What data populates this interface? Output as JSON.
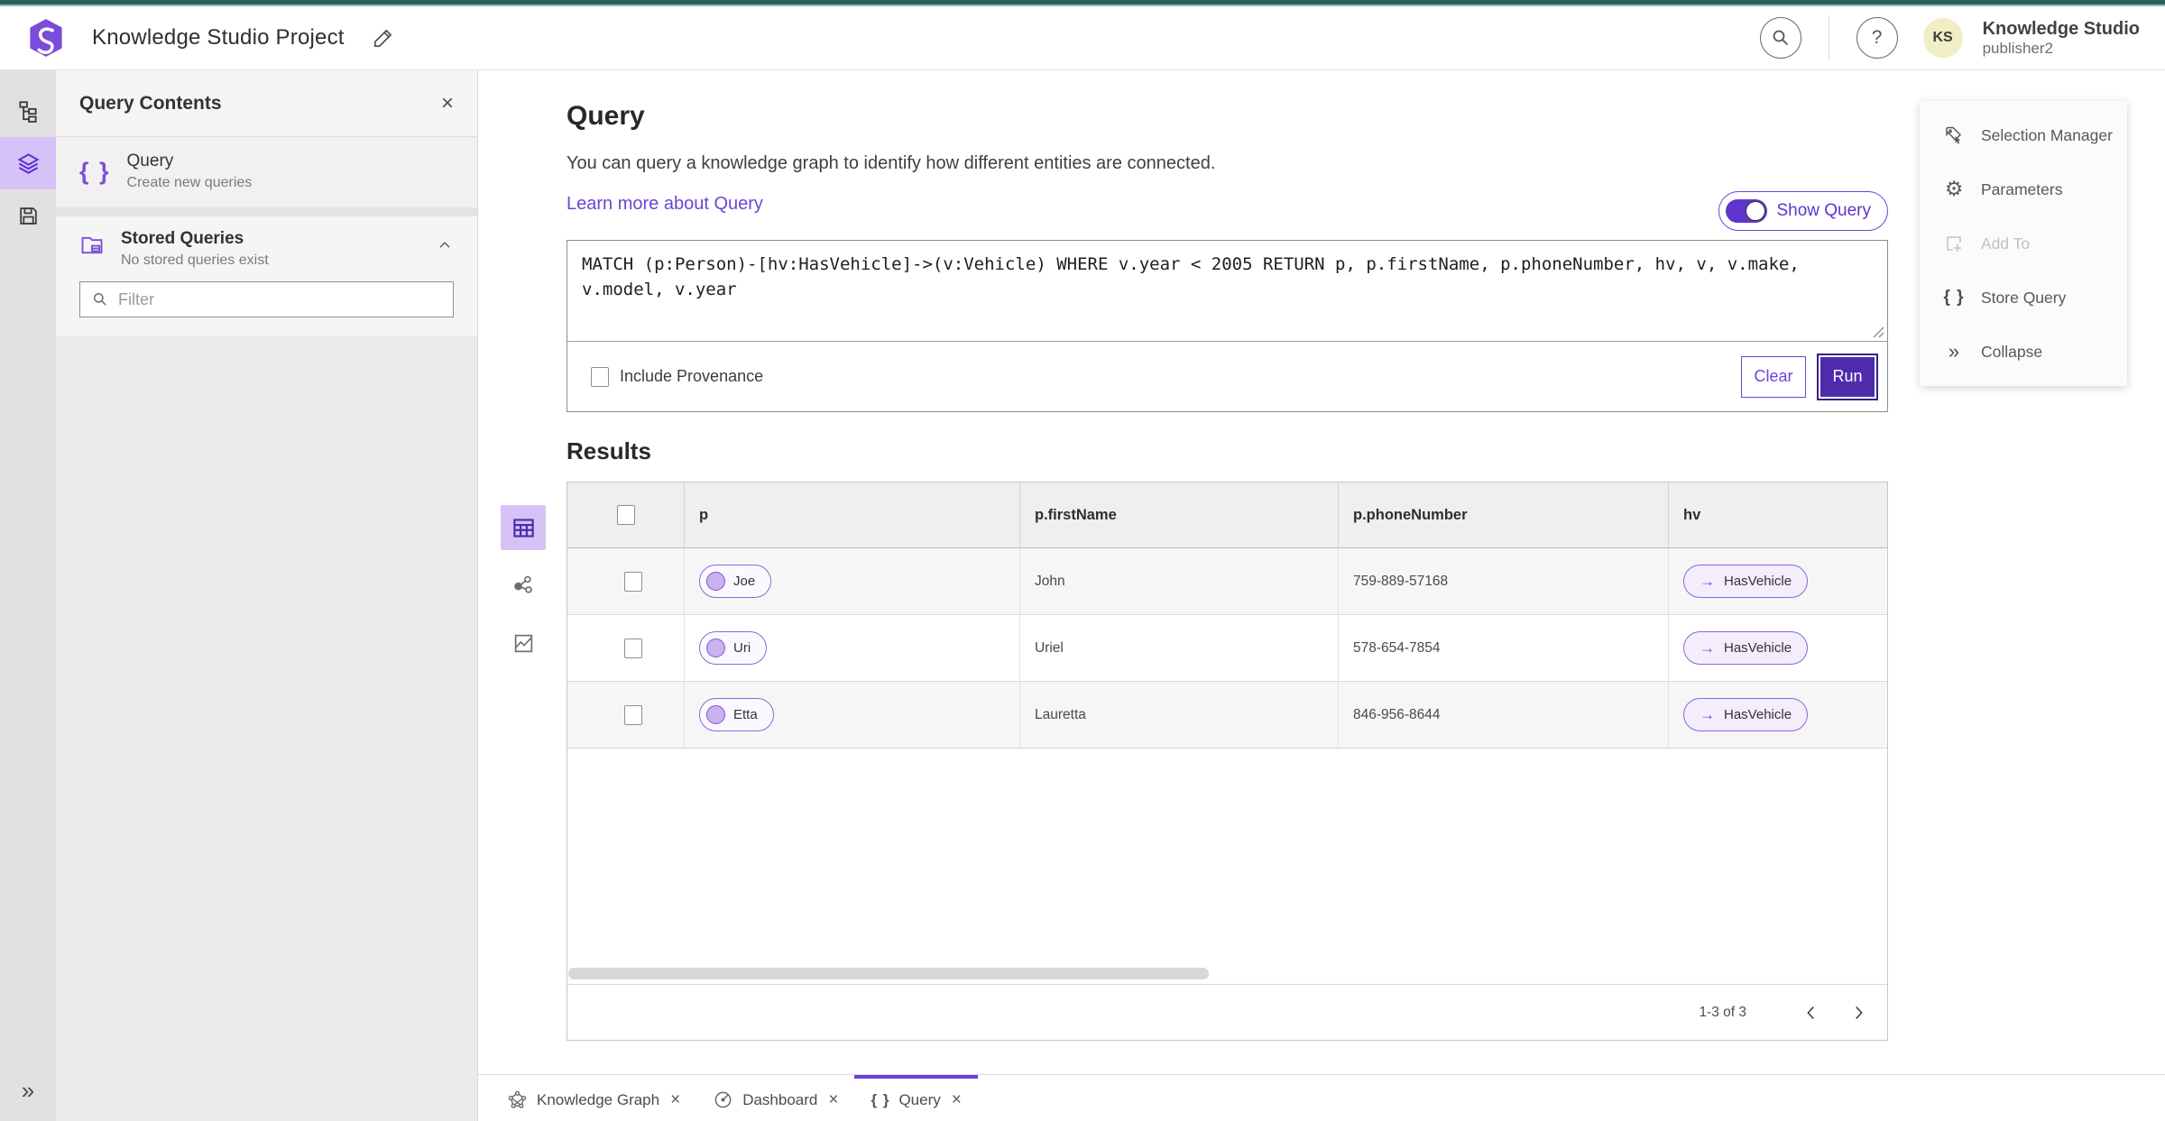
{
  "colors": {
    "accent_purple": "#6b44d8",
    "deep_purple": "#4f2bac",
    "light_purple_bg": "#d6c2f6",
    "teal_bar": "#265f5e",
    "avatar_bg": "#f1edc4"
  },
  "icons": {
    "logo": "hexagon-swirl",
    "edit": "pencil",
    "search": "magnifier",
    "help_glyph": "?",
    "close_glyph": "×",
    "rail": [
      "hierarchy-tree",
      "layers",
      "save-floppy"
    ],
    "double_chevron_glyph": "»",
    "braces_glyph": "{ }",
    "arrow_right_glyph": "→",
    "gear_glyph": "⚙",
    "view_modes": [
      "table-grid",
      "network-graph",
      "map-route"
    ],
    "tab_icons": [
      "graph-network",
      "gauge",
      "braces"
    ]
  },
  "header": {
    "app_title": "Knowledge Studio Project",
    "user": {
      "initials": "KS",
      "product": "Knowledge Studio",
      "username": "publisher2"
    }
  },
  "left_panel": {
    "title": "Query Contents",
    "query_item": {
      "title": "Query",
      "subtitle": "Create new queries"
    },
    "stored": {
      "title": "Stored Queries",
      "subtitle": "No stored queries exist"
    },
    "filter_placeholder": "Filter"
  },
  "main": {
    "title": "Query",
    "description": "You can query a knowledge graph to identify how different entities are connected.",
    "learn_more": "Learn more about Query",
    "show_query_label": "Show Query",
    "query_text": "MATCH (p:Person)-[hv:HasVehicle]->(v:Vehicle) WHERE v.year < 2005 RETURN p, p.firstName, p.phoneNumber, hv, v, v.make, v.model, v.year",
    "include_provenance_label": "Include Provenance",
    "clear_label": "Clear",
    "run_label": "Run",
    "results_title": "Results"
  },
  "results_table": {
    "columns": [
      "p",
      "p.firstName",
      "p.phoneNumber",
      "hv"
    ],
    "rows": [
      {
        "p": "Joe",
        "firstName": "John",
        "phoneNumber": "759-889-57168",
        "hv": "HasVehicle"
      },
      {
        "p": "Uri",
        "firstName": "Uriel",
        "phoneNumber": "578-654-7854",
        "hv": "HasVehicle"
      },
      {
        "p": "Etta",
        "firstName": "Lauretta",
        "phoneNumber": "846-956-8644",
        "hv": "HasVehicle"
      }
    ],
    "pagination": {
      "label": "1-3 of 3"
    }
  },
  "right_panel": {
    "items": [
      {
        "label": "Selection Manager",
        "disabled": false
      },
      {
        "label": "Parameters",
        "disabled": false
      },
      {
        "label": "Add To",
        "disabled": true
      },
      {
        "label": "Store Query",
        "disabled": false
      },
      {
        "label": "Collapse",
        "disabled": false
      }
    ]
  },
  "bottom_tabs": [
    {
      "label": "Knowledge Graph",
      "active": false
    },
    {
      "label": "Dashboard",
      "active": false
    },
    {
      "label": "Query",
      "active": true
    }
  ]
}
